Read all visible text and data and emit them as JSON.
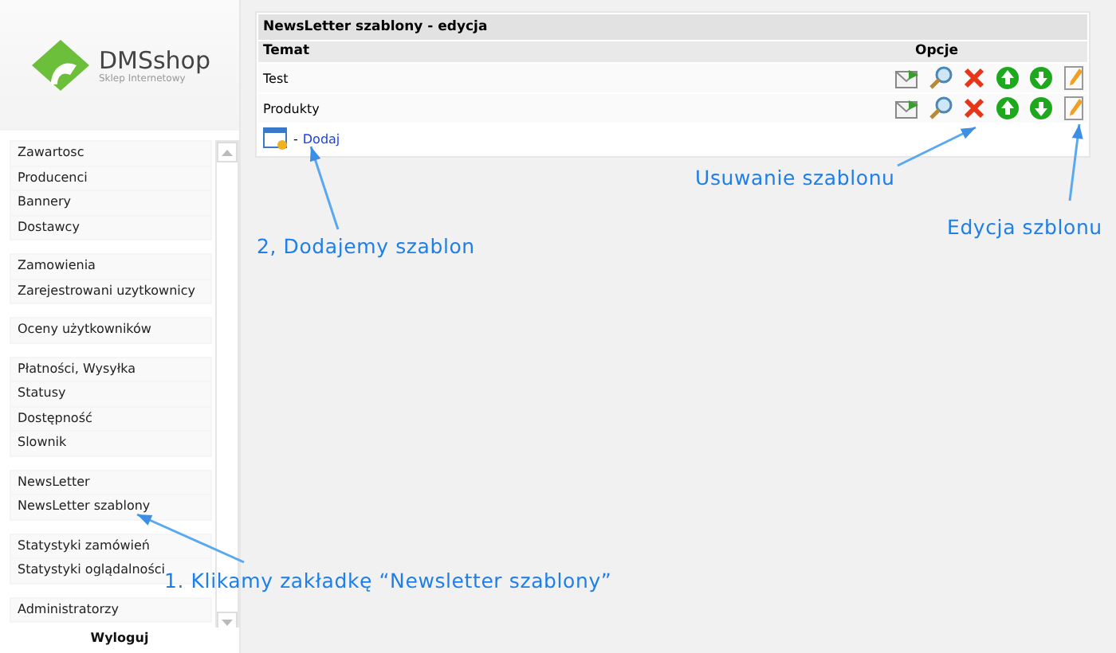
{
  "sidebar": {
    "logo": {
      "name": "DMSshop",
      "tagline": "Sklep Internetowy"
    },
    "groups": [
      {
        "items": [
          {
            "label": "Zawartosc"
          },
          {
            "label": "Producenci"
          },
          {
            "label": "Bannery"
          },
          {
            "label": "Dostawcy"
          }
        ]
      },
      {
        "items": [
          {
            "label": "Zamowienia"
          },
          {
            "label": "Zarejestrowani uzytkownicy"
          }
        ]
      },
      {
        "items": [
          {
            "label": "Oceny użytkowników"
          }
        ]
      },
      {
        "items": [
          {
            "label": "Płatności, Wysyłka"
          },
          {
            "label": "Statusy"
          },
          {
            "label": "Dostępność"
          },
          {
            "label": "Slownik"
          }
        ]
      },
      {
        "items": [
          {
            "label": "NewsLetter"
          },
          {
            "label": "NewsLetter szablony"
          }
        ]
      },
      {
        "items": [
          {
            "label": "Statystyki zamówień"
          },
          {
            "label": "Statystyki oglądalności"
          }
        ]
      },
      {
        "items": [
          {
            "label": "Administratorzy"
          }
        ]
      }
    ],
    "logout": "Wyloguj"
  },
  "panel": {
    "title": "NewsLetter szablony - edycja",
    "columns": [
      "Temat",
      "Opcje"
    ],
    "rows": [
      {
        "subject": "Test",
        "options": [
          {
            "kind": "send"
          },
          {
            "kind": "preview"
          },
          {
            "kind": "delete"
          },
          {
            "kind": "up"
          },
          {
            "kind": "down"
          },
          {
            "kind": "edit"
          }
        ]
      },
      {
        "subject": "Produkty",
        "options": [
          {
            "kind": "send"
          },
          {
            "kind": "preview"
          },
          {
            "kind": "delete"
          },
          {
            "kind": "up"
          },
          {
            "kind": "down"
          },
          {
            "kind": "edit"
          }
        ]
      }
    ],
    "add": {
      "separator": "-",
      "label": "Dodaj"
    }
  },
  "annotations": [
    {
      "text": "Usuwanie szablonu"
    },
    {
      "text": "Edycja szblonu"
    },
    {
      "text": "2, Dodajemy szablon"
    },
    {
      "text": "1. Klikamy zakładkę “Newsletter szablony”"
    }
  ]
}
